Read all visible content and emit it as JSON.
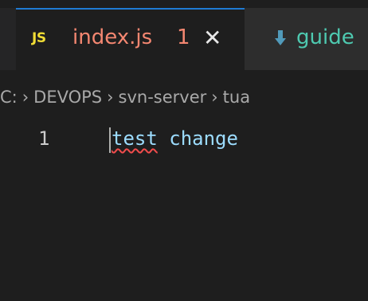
{
  "tabs": [
    {
      "icon": "javascript-file-icon",
      "icon_text": "JS",
      "label": "index.js",
      "problem_count": "1",
      "close_glyph": "✕",
      "active": true
    },
    {
      "icon": "markdown-download-icon",
      "label": "guide",
      "active": false
    }
  ],
  "breadcrumb": [
    "C:",
    "DEVOPS",
    "svn-server",
    "tua"
  ],
  "breadcrumb_separator": "›",
  "editor": {
    "lines": [
      {
        "number": "1",
        "tokens": [
          "test",
          " change"
        ]
      }
    ]
  },
  "colors": {
    "background": "#1e1e1e",
    "tab_bar": "#252526",
    "active_tab_border": "#1f7bd3",
    "error_text": "#f48771",
    "js_icon": "#f1dd35",
    "code_text": "#9cdcfe",
    "squiggle": "#f14c4c"
  }
}
